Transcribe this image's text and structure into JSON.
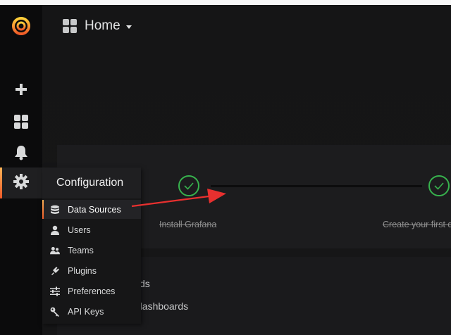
{
  "header": {
    "title": "Home"
  },
  "sidebar": {
    "items": [
      {
        "name": "grafana-logo",
        "icon": "grafana-logo-icon"
      },
      {
        "name": "create",
        "icon": "plus-icon"
      },
      {
        "name": "dashboards",
        "icon": "grid-icon"
      },
      {
        "name": "alerting",
        "icon": "bell-icon"
      },
      {
        "name": "configuration",
        "icon": "gear-icon",
        "active": true
      }
    ]
  },
  "config_menu": {
    "title": "Configuration",
    "items": [
      {
        "label": "Data Sources",
        "icon": "database-icon",
        "active": true
      },
      {
        "label": "Users",
        "icon": "user-icon"
      },
      {
        "label": "Teams",
        "icon": "users-icon"
      },
      {
        "label": "Plugins",
        "icon": "plug-icon"
      },
      {
        "label": "Preferences",
        "icon": "sliders-icon"
      },
      {
        "label": "API Keys",
        "icon": "key-icon"
      }
    ]
  },
  "progress": {
    "steps": [
      {
        "label": "Install Grafana",
        "done": true
      },
      {
        "label": "Create your first d",
        "done": true
      }
    ]
  },
  "lower_panel": {
    "lines": [
      "ds",
      "dashboards"
    ]
  },
  "colors": {
    "accent": "#f05a28",
    "success": "#37b24d",
    "annotation": "#e8302f"
  }
}
